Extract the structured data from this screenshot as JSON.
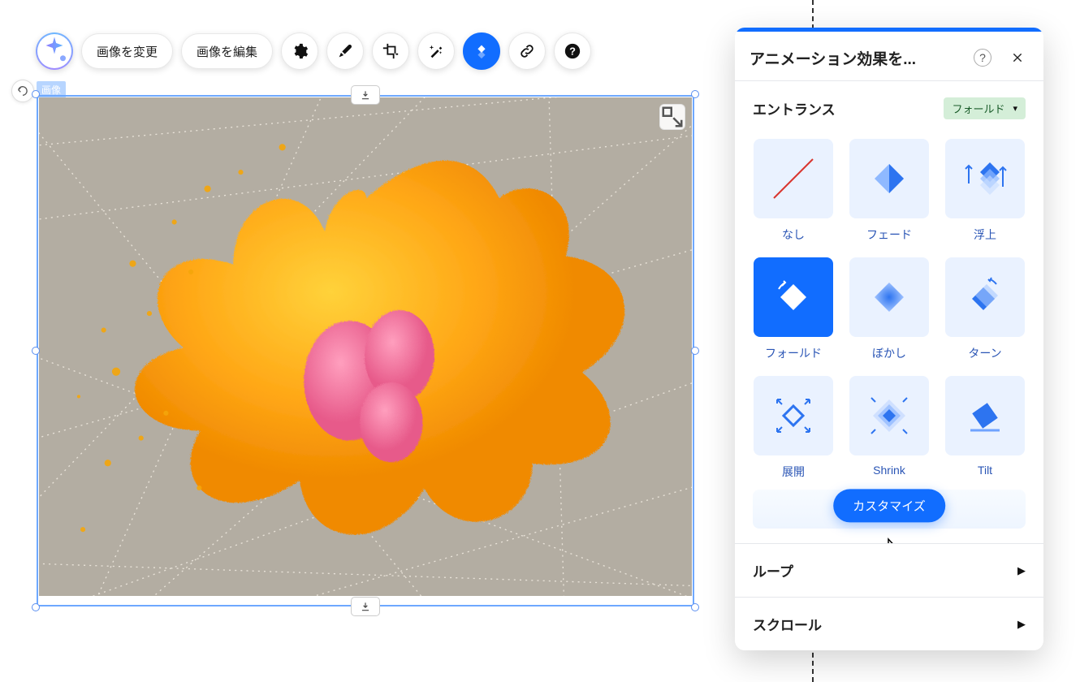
{
  "toolbar": {
    "change_image": "画像を変更",
    "edit_image": "画像を編集"
  },
  "canvas": {
    "tag": "画像"
  },
  "panel": {
    "title": "アニメーション効果を...",
    "help": "?",
    "sections": {
      "entrance": {
        "title": "エントランス",
        "tag": "フォールド"
      },
      "loop": {
        "title": "ループ"
      },
      "scroll": {
        "title": "スクロール"
      }
    },
    "effects": [
      {
        "id": "none",
        "label": "なし"
      },
      {
        "id": "fade",
        "label": "フェード"
      },
      {
        "id": "float",
        "label": "浮上"
      },
      {
        "id": "fold",
        "label": "フォールド",
        "selected": true
      },
      {
        "id": "blur",
        "label": "ぼかし"
      },
      {
        "id": "turn",
        "label": "ターン"
      },
      {
        "id": "expand",
        "label": "展開"
      },
      {
        "id": "shrink",
        "label": "Shrink"
      },
      {
        "id": "tilt",
        "label": "Tilt"
      }
    ],
    "customize": "カスタマイズ"
  }
}
